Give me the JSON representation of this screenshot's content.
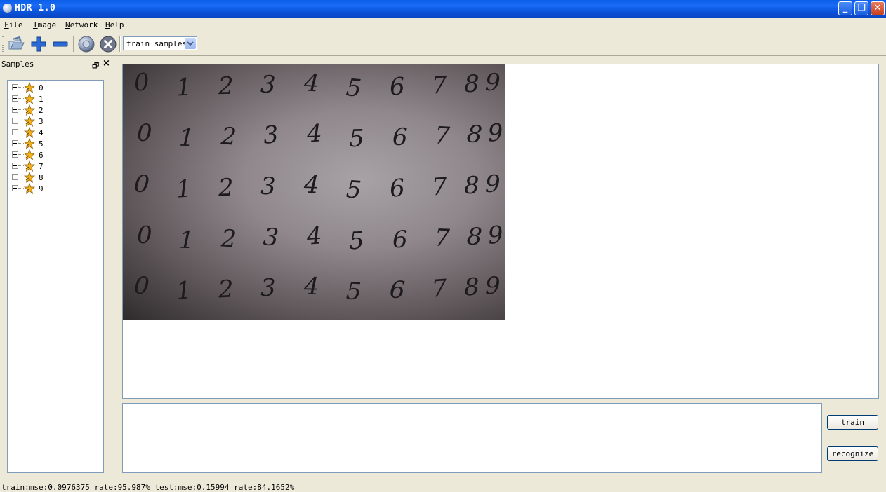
{
  "window": {
    "title": "HDR 1.0",
    "accent": "#0a5ee8"
  },
  "menu": {
    "file": {
      "first": "F",
      "rest": "ile"
    },
    "image": {
      "first": "I",
      "rest": "mage"
    },
    "network": {
      "first": "N",
      "rest": "etwork"
    },
    "help": {
      "first": "H",
      "rest": "elp"
    }
  },
  "toolbar": {
    "icons": [
      "open-folder-icon",
      "add-icon",
      "remove-icon",
      "camera-icon",
      "stop-icon"
    ],
    "mode_select": {
      "value": "train samples"
    }
  },
  "samples_panel": {
    "title": "Samples",
    "items": [
      {
        "label": "0"
      },
      {
        "label": "1"
      },
      {
        "label": "2"
      },
      {
        "label": "3"
      },
      {
        "label": "4"
      },
      {
        "label": "5"
      },
      {
        "label": "6"
      },
      {
        "label": "7"
      },
      {
        "label": "8"
      },
      {
        "label": "9"
      }
    ]
  },
  "image_view": {
    "photo_rows": [
      [
        "0",
        "1",
        "2",
        "3",
        "4",
        "5",
        "6",
        "7",
        "8",
        "9"
      ],
      [
        "0",
        "1",
        "2",
        "3",
        "4",
        "5",
        "6",
        "7",
        "8",
        "9"
      ],
      [
        "0",
        "1",
        "2",
        "3",
        "4",
        "5",
        "6",
        "7",
        "8",
        "9"
      ],
      [
        "0",
        "1",
        "2",
        "3",
        "4",
        "5",
        "6",
        "7",
        "8",
        "9"
      ],
      [
        "0",
        "1",
        "2",
        "3",
        "4",
        "5",
        "6",
        "7",
        "8",
        "9"
      ]
    ]
  },
  "actions": {
    "train": "train",
    "recognize": "recognize"
  },
  "status": {
    "text": "train:mse:0.0976375 rate:95.987% test:mse:0.15994 rate:84.1652%"
  }
}
